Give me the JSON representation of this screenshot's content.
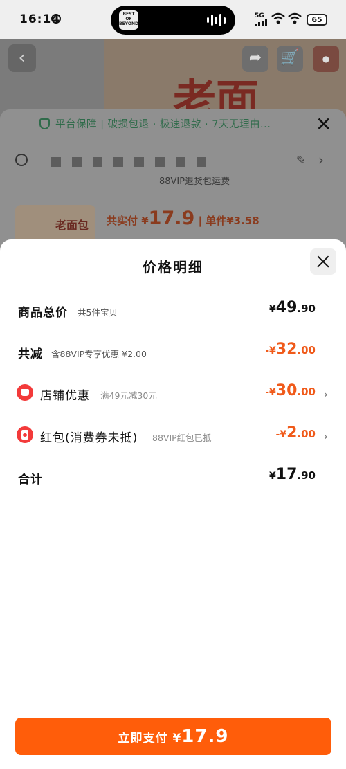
{
  "status": {
    "time": "16:14",
    "network": "5G",
    "battery": "65",
    "island_thumb_text": "BEST OF BEYOND"
  },
  "background": {
    "banner_char": "老面",
    "guarantee": "平台保障 | 破损包退 · 极速退款 · 7天无理由...",
    "shipping": "88VIP退货包运费",
    "pay_summary": {
      "prefix": "共实付 ¥",
      "amount": "17.9",
      "unit_price": " | 单件¥3.58"
    },
    "product_thumb_text": "老面包"
  },
  "modal": {
    "title": "价格明细",
    "rows": [
      {
        "label": "商品总价",
        "note": "共5件宝贝",
        "currency": "¥",
        "int": "49",
        "cents": ".90"
      },
      {
        "label": "共减",
        "note": "含88VIP专享优惠 ¥2.00",
        "currency": "-¥",
        "int": "32",
        "cents": ".00"
      },
      {
        "label": "店铺优惠",
        "note": "满49元减30元",
        "currency": "-¥",
        "int": "30",
        "cents": ".00"
      },
      {
        "label": "红包(消费券未抵)",
        "note": "88VIP红包已抵",
        "currency": "-¥",
        "int": "2",
        "cents": ".00"
      },
      {
        "label": "合计",
        "currency": "¥",
        "int": "17",
        "cents": ".90"
      }
    ]
  },
  "pay_button": {
    "label": "立即支付",
    "currency": "¥",
    "amount": "17.9"
  },
  "colors": {
    "accent": "#ff5d0a",
    "discount": "#f05a1a",
    "badge": "#f33a3a"
  }
}
